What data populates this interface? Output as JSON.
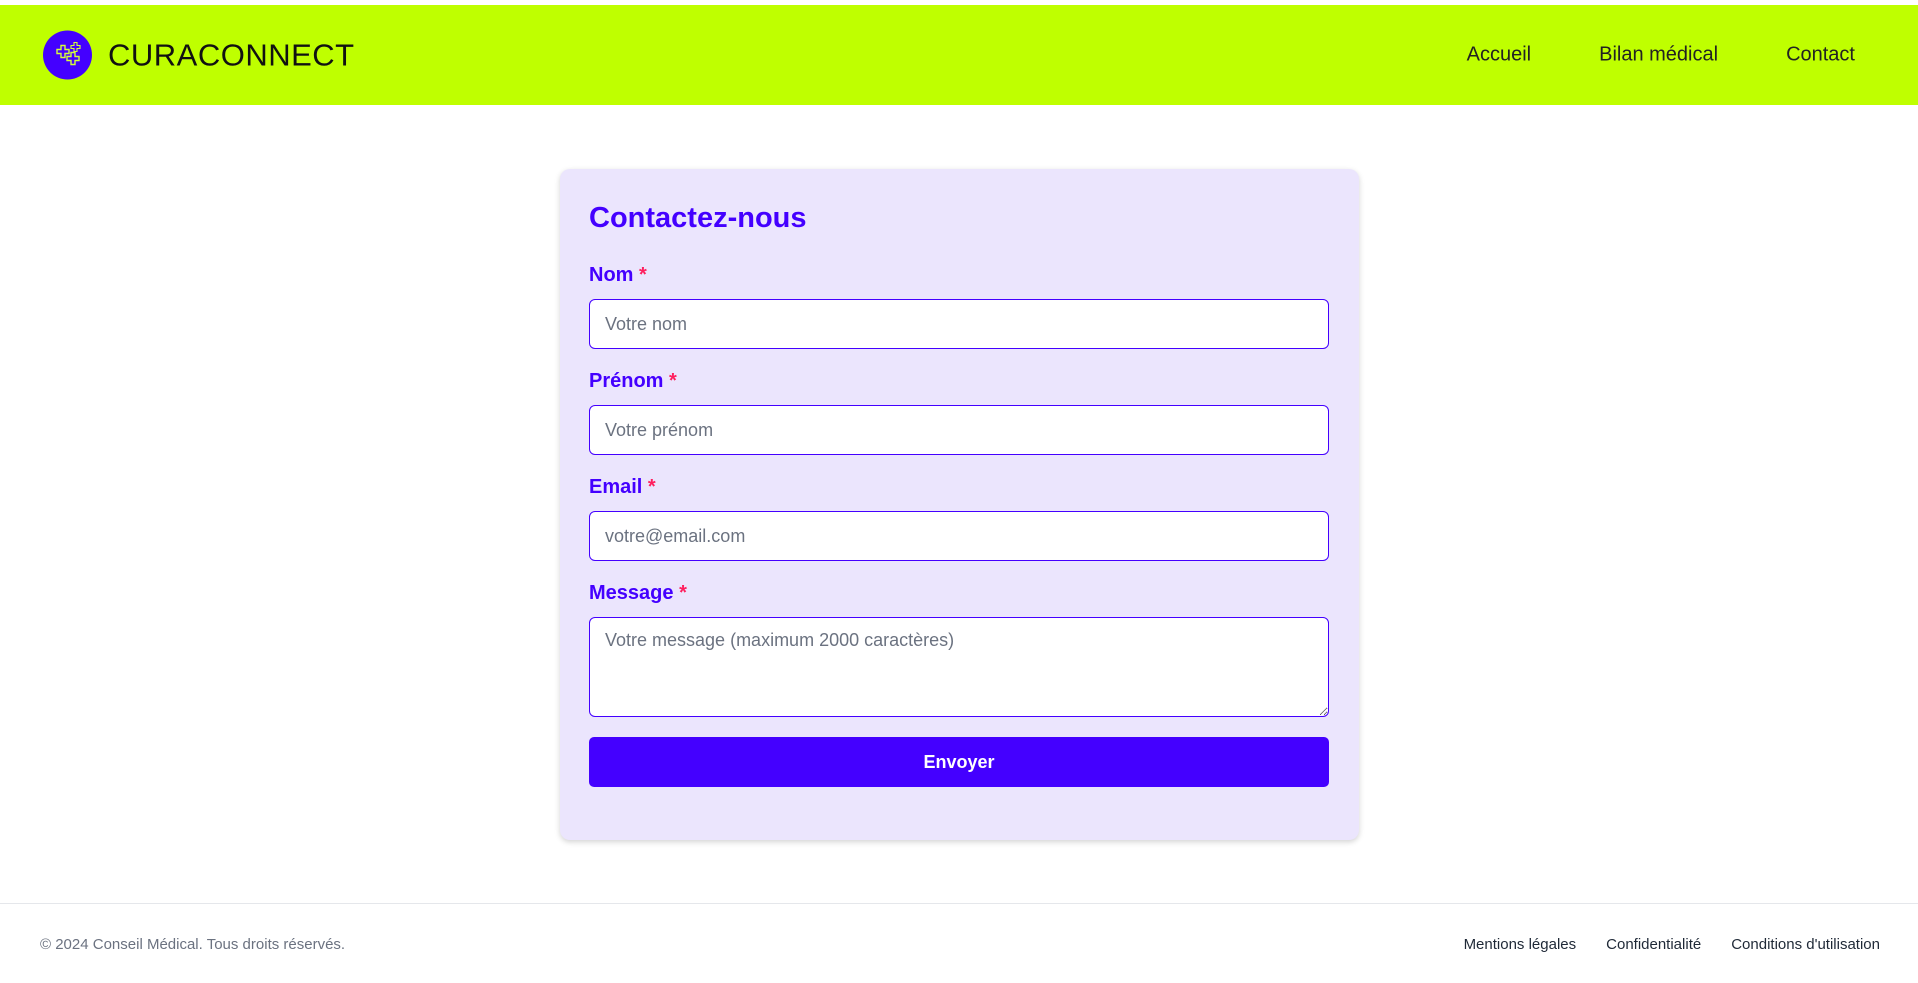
{
  "header": {
    "brand": "CURACONNECT",
    "logo_icon": "medical-crosses-icon",
    "colors": {
      "background": "#bfff00",
      "logo_circle": "#4400ff"
    },
    "nav": [
      {
        "label": "Accueil"
      },
      {
        "label": "Bilan médical"
      },
      {
        "label": "Contact"
      }
    ]
  },
  "form": {
    "title": "Contactez-nous",
    "required_marker": "*",
    "fields": {
      "nom": {
        "label": "Nom",
        "placeholder": "Votre nom",
        "value": ""
      },
      "prenom": {
        "label": "Prénom",
        "placeholder": "Votre prénom",
        "value": ""
      },
      "email": {
        "label": "Email",
        "placeholder": "votre@email.com",
        "value": ""
      },
      "message": {
        "label": "Message",
        "placeholder": "Votre message (maximum 2000 caractères)",
        "value": ""
      }
    },
    "submit_label": "Envoyer",
    "colors": {
      "accent": "#4400ff",
      "card_background": "#ebe5fd",
      "required": "#ff1f5e"
    }
  },
  "footer": {
    "copyright": "© 2024 Conseil Médical. Tous droits réservés.",
    "links": [
      {
        "label": "Mentions légales"
      },
      {
        "label": "Confidentialité"
      },
      {
        "label": "Conditions d'utilisation"
      }
    ]
  }
}
